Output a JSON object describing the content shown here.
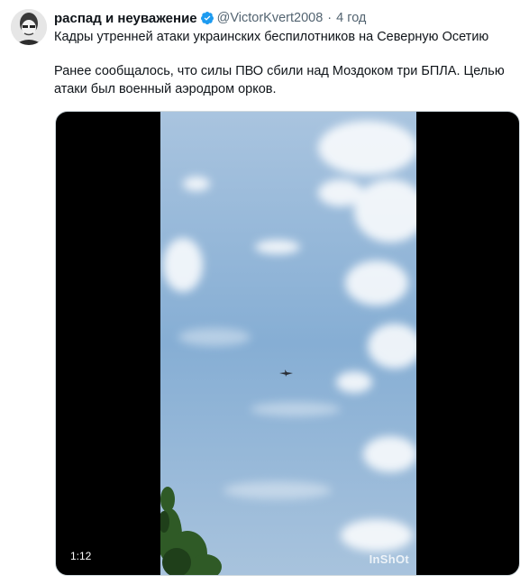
{
  "tweet": {
    "display_name": "распад и неуважение",
    "handle": "@VictorKvert2008",
    "separator": "·",
    "time": "4 год",
    "verified_icon": "verified-badge-icon",
    "verified_color": "#1d9bf0",
    "paragraph_1": "Кадры утренней атаки украинских беспилотников на Северную Осетию",
    "paragraph_2": "Ранее сообщалось, что силы ПВО сбили над Моздоком три БПЛА. Целью атаки был военный аэродром орков."
  },
  "media": {
    "duration": "1:12",
    "watermark": "InShOt",
    "sky_color": "#8eb3d6",
    "background": "#000000"
  }
}
